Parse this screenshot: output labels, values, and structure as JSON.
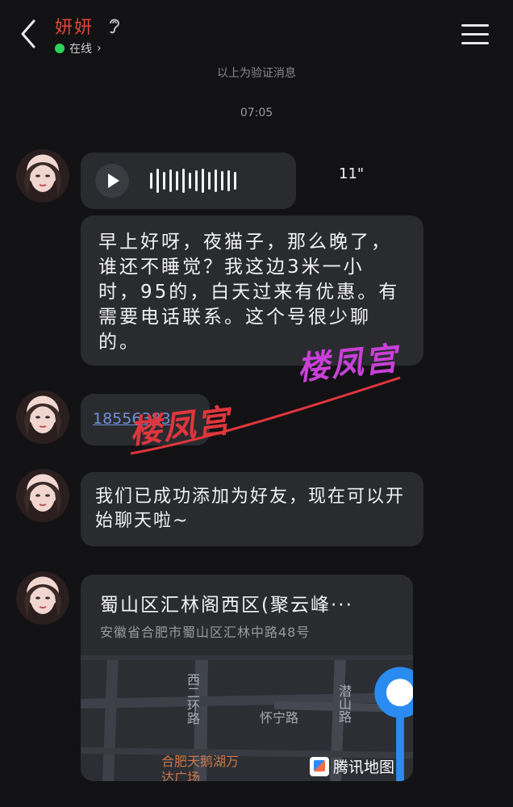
{
  "header": {
    "back_icon": "chevron-left-icon",
    "title": "妍妍",
    "ear_icon": "ear-icon",
    "status_label": "在线",
    "status_color": "#2fd35a",
    "menu_icon": "hamburger-menu-icon"
  },
  "system": {
    "partial_notice": "以上为验证消息",
    "timestamp": "07:05"
  },
  "messages": {
    "voice": {
      "play_icon": "play-icon",
      "duration": "11\""
    },
    "text1": "早上好呀，夜猫子，那么晚了，谁还不睡觉？我这边3米一小时，95的，白天过来有优惠。有需要电话联系。这个号很少聊的。",
    "phone_number": "18556383",
    "text3": "我们已成功添加为好友，现在可以开始聊天啦~",
    "location": {
      "title": "蜀山区汇林阁西区(聚云峰···",
      "address": "安徽省合肥市蜀山区汇林中路48号",
      "map_labels": [
        "西二环路",
        "怀宁路",
        "潜山路",
        "合肥天鹅湖万达广场"
      ],
      "map_brand": "腾讯地图",
      "pin_icon": "location-pin-icon"
    }
  },
  "watermark": {
    "text_top": "楼凤宫",
    "text_bottom": "楼凤宫"
  }
}
